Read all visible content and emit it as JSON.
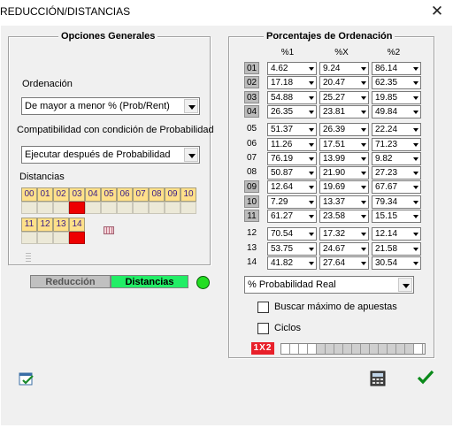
{
  "window": {
    "title": "REDUCCIÓN/DISTANCIAS",
    "close_glyph": "✕"
  },
  "opciones": {
    "legend": "Opciones Generales",
    "ordenacion_label": "Ordenación",
    "ordenacion_value": "De mayor a menor % (Prob/Rent)",
    "compat_label": "Compatibilidad con condición de Probabilidad",
    "compat_value": "Ejecutar después de Probabilidad",
    "distancias_label": "Distancias",
    "dist_row1": [
      "00",
      "01",
      "02",
      "03",
      "04",
      "05",
      "06",
      "07",
      "08",
      "09",
      "10"
    ],
    "dist_row1_marked": [
      3
    ],
    "dist_row2": [
      "11",
      "12",
      "13",
      "14"
    ],
    "dist_row2_marked": [
      3
    ]
  },
  "tabs": {
    "reduccion": "Reducción",
    "distancias": "Distancias"
  },
  "status_color": "#22dd22",
  "porcentajes": {
    "legend": "Porcentajes de Ordenación",
    "headers": [
      "%1",
      "%X",
      "%2"
    ],
    "rows": [
      {
        "n": "01",
        "v": [
          "4.62",
          "9.24",
          "86.14"
        ],
        "dark": true
      },
      {
        "n": "02",
        "v": [
          "17.18",
          "20.47",
          "62.35"
        ],
        "dark": true
      },
      {
        "n": "03",
        "v": [
          "54.88",
          "25.27",
          "19.85"
        ],
        "dark": true
      },
      {
        "n": "04",
        "v": [
          "26.35",
          "23.81",
          "49.84"
        ],
        "dark": true
      },
      {
        "n": "05",
        "v": [
          "51.37",
          "26.39",
          "22.24"
        ],
        "dark": false
      },
      {
        "n": "06",
        "v": [
          "11.26",
          "17.51",
          "71.23"
        ],
        "dark": false
      },
      {
        "n": "07",
        "v": [
          "76.19",
          "13.99",
          "9.82"
        ],
        "dark": false
      },
      {
        "n": "08",
        "v": [
          "50.87",
          "21.90",
          "27.23"
        ],
        "dark": false
      },
      {
        "n": "09",
        "v": [
          "12.64",
          "19.69",
          "67.67"
        ],
        "dark": true
      },
      {
        "n": "10",
        "v": [
          "7.29",
          "13.37",
          "79.34"
        ],
        "dark": true
      },
      {
        "n": "11",
        "v": [
          "61.27",
          "23.58",
          "15.15"
        ],
        "dark": true
      },
      {
        "n": "12",
        "v": [
          "70.54",
          "17.32",
          "12.14"
        ],
        "dark": false
      },
      {
        "n": "13",
        "v": [
          "53.75",
          "24.67",
          "21.58"
        ],
        "dark": false
      },
      {
        "n": "14",
        "v": [
          "41.82",
          "27.64",
          "30.54"
        ],
        "dark": false
      }
    ],
    "prob_value": "% Probabilidad Real",
    "buscar_label": "Buscar máximo de apuestas",
    "ciclos_label": "Ciclos",
    "badge": "1X2"
  },
  "icons": {
    "bottom_left": "calendar-check-icon",
    "calculator": "calculator-icon",
    "ok": "checkmark-icon"
  }
}
